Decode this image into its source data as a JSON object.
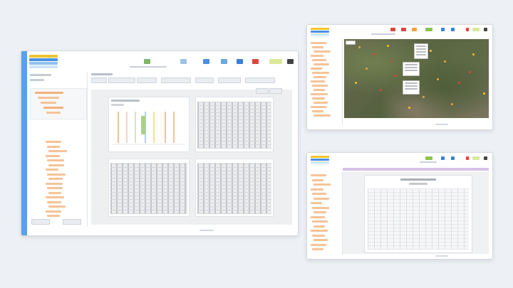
{
  "scene": {
    "description_hidden": ""
  },
  "colors": {
    "background": "#edf0f4",
    "accent_blue": "#3b7fd9",
    "accent_orange": "#f0a33a",
    "accent_red": "#e0433b",
    "accent_green": "#8bc34a",
    "logo_yellow": "#f2c230",
    "logo_blue": "#4a8fe0",
    "purple_bar": "#b48fd6"
  },
  "windows": [
    {
      "id": "main",
      "icon_names": [
        "report-icon",
        "chart-icon",
        "table-icon",
        "export-icon",
        "print-icon",
        "close-icon"
      ]
    },
    {
      "id": "map",
      "icon_names": [
        "map-icon",
        "layer-icon",
        "search-icon",
        "settings-icon",
        "alert-icon",
        "close-icon"
      ]
    },
    {
      "id": "document",
      "icon_names": [
        "doc-icon",
        "print-icon",
        "export-icon",
        "close-icon"
      ]
    }
  ],
  "chart_preview": {
    "type": "line",
    "series_colors": [
      "#f4b183",
      "#f8cbad",
      "#c6e0b4",
      "#9dc3e6",
      "#ffd966",
      "#f4b183"
    ]
  }
}
